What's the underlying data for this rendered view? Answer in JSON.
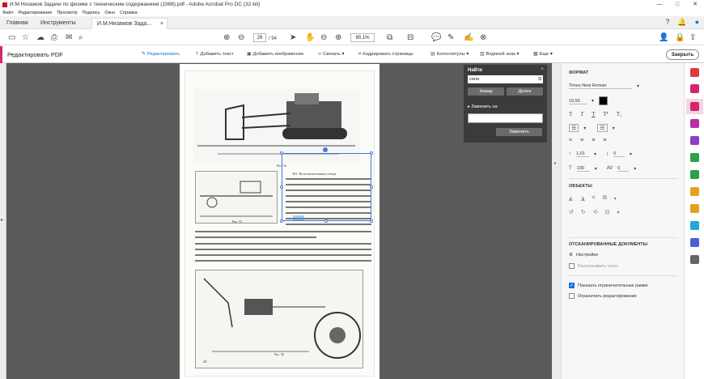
{
  "window": {
    "title": "И.М.Низамов Задачи по физике с техническим содержанием (1988).pdf - Adobe Acrobat Pro DC (32-bit)",
    "controls": [
      "—",
      "□",
      "✕"
    ]
  },
  "menu": [
    "Файл",
    "Редактирование",
    "Просмотр",
    "Подпись",
    "Окно",
    "Справка"
  ],
  "tabs": [
    {
      "label": "Главная"
    },
    {
      "label": "Инструменты"
    },
    {
      "label": "И.М.Низамов Зада..."
    }
  ],
  "tab_close": "×",
  "toolbar": {
    "page_current": "29",
    "page_total": "/ 94",
    "zoom": "90,1%"
  },
  "edit_toolbar": {
    "label": "Редактировать PDF",
    "edit": "Редактировать",
    "add_text": "Добавить текст",
    "add_image": "Добавить изображение",
    "link": "Связать",
    "crop": "Кадрировать страницы",
    "headers": "Колонтитулы",
    "watermark": "Водяной знак",
    "more": "Еще",
    "close": "Закрыть"
  },
  "find": {
    "title": "Найти",
    "close": "×",
    "query": "сила",
    "prev": "Назад",
    "next": "Далее",
    "replace_label": "Заменить на",
    "replace_btn": "Заменить"
  },
  "format": {
    "title": "ФОРМАТ",
    "font": "Times New Roman",
    "size": "10,50",
    "text_color": "#000000",
    "line_spacing": "1,01",
    "para_spacing": "0",
    "scale": "100",
    "char_spacing": "0"
  },
  "objects": {
    "title": "ОБЪЕКТЫ"
  },
  "scanned": {
    "title": "ОТСКАНИРОВАННЫЕ ДОКУМЕНТЫ",
    "settings": "Настройки",
    "recognize": "Распознавать текст"
  },
  "options": {
    "show_bounds": "Показать ограничительные рамки",
    "restrict": "Ограничить редактирование"
  },
  "page_content": {
    "fig54": "Рис. 54",
    "fig55": "Рис. 55",
    "fig56": "Рис. 56",
    "page_number": "28",
    "problem": "181. На испытательном стенде"
  },
  "colors": {
    "accent": "#1473e6",
    "edit_bar": "#d6246e"
  }
}
